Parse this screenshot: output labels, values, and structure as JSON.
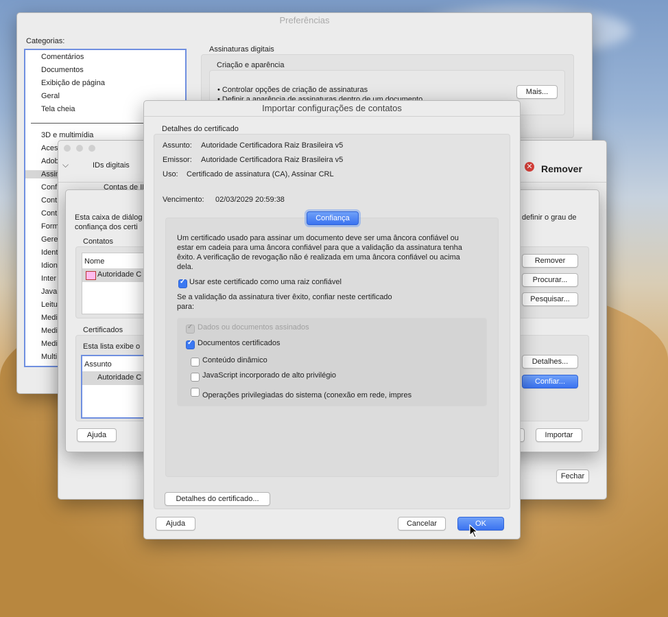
{
  "prefs": {
    "title": "Preferências",
    "categories_label": "Categorias:",
    "cat_top": [
      "Comentários",
      "Documentos",
      "Exibição de página",
      "Geral",
      "Tela cheia"
    ],
    "cat_bottom": [
      "3D e multimídia",
      "Aces",
      "Adob",
      "Assin",
      "Conf",
      "Cont",
      "Cont",
      "Form",
      "Gere",
      "Ident",
      "Idion",
      "Inter",
      "Java",
      "Leitu",
      "Medi",
      "Medi",
      "Medi",
      "Multi"
    ],
    "section_title": "Assinaturas digitais",
    "subsection": "Criação e aparência",
    "bullet1": "• Controlar opções de criação de assinaturas",
    "bullet2": "• Definir a aparência de assinaturas dentro de um documento",
    "more_button": "Mais..."
  },
  "ids_window": {
    "title": "IDs digitais",
    "contas": "Contas de ID",
    "remove_label": "Remover",
    "close_button": "Fechar"
  },
  "contacts_dialog": {
    "desc_line1": "Esta caixa de diálog",
    "desc_line2": "confiança dos certi",
    "desc_right": "definir o grau de",
    "contacts_label": "Contatos",
    "col_name": "Nome",
    "contact_item": "Autoridade C",
    "remove_button": "Remover",
    "browse_button": "Procurar...",
    "search_button": "Pesquisar...",
    "certs_label": "Certificados",
    "certs_desc": "Esta lista exibe o",
    "col_subject": "Assunto",
    "cert_item": "Autoridade C",
    "details_button": "Detalhes...",
    "trust_button": "Confiar...",
    "help_button": "Ajuda",
    "import_button": "Importar"
  },
  "import_dialog": {
    "title": "Importar configurações de contatos",
    "details_header": "Detalhes do certificado",
    "subject_label": "Assunto:",
    "subject_value": "Autoridade Certificadora Raiz Brasileira v5",
    "issuer_label": "Emissor:",
    "issuer_value": "Autoridade Certificadora Raiz Brasileira v5",
    "usage_label": "Uso:",
    "usage_value": "Certificado de assinatura (CA), Assinar CRL",
    "expiry_label": "Vencimento:",
    "expiry_value": "02/03/2029 20:59:38",
    "tab_trust": "Confiança",
    "para1": "Um certificado usado para assinar um documento deve ser uma âncora confiável ou",
    "para2": "estar em cadeia para uma âncora confiável para que a validação da assinatura tenha",
    "para3": "êxito. A verificação de revogação não é realizada em uma âncora confiável ou acima",
    "para4": "dela.",
    "use_root": "Usar este certificado como uma raiz confiável",
    "trust_line1": "Se a validação da assinatura tiver êxito, confiar neste certificado",
    "trust_line2": "para:",
    "opt_signed": "Dados ou documentos assinados",
    "opt_certified": "Documentos certificados",
    "opt_dynamic": "Conteúdo dinâmico",
    "opt_js": "JavaScript incorporado de alto privilégio",
    "opt_system": "Operações privilegiadas do sistema (conexão em rede, impres",
    "cert_details_button": "Detalhes do certificado...",
    "help_button": "Ajuda",
    "cancel_button": "Cancelar",
    "ok_button": "OK"
  },
  "colors": {
    "accent": "#3b78f2",
    "remove_red": "#d9403a"
  }
}
